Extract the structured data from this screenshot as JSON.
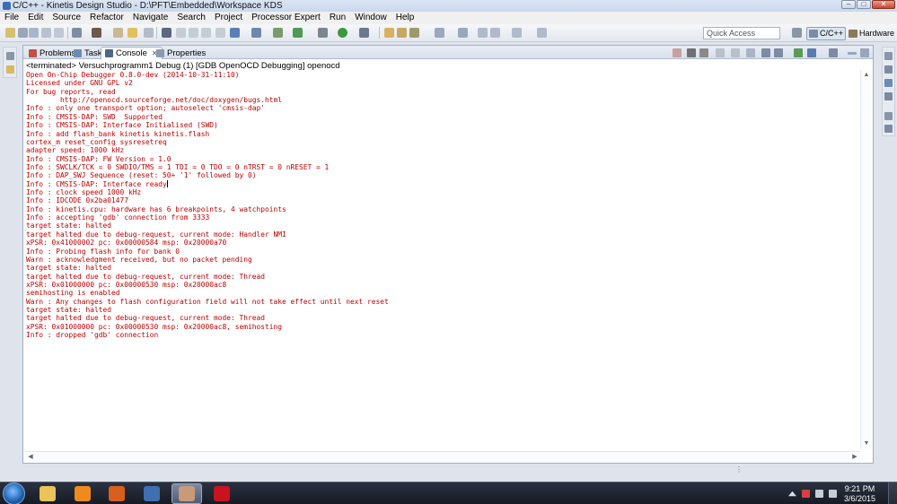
{
  "window": {
    "title": "C/C++ - Kinetis Design Studio - D:\\PFT\\Embedded\\Workspace KDS",
    "controls": {
      "minimize": "–",
      "maximize": "□",
      "close": "✕"
    }
  },
  "menu": [
    "File",
    "Edit",
    "Source",
    "Refactor",
    "Navigate",
    "Search",
    "Project",
    "Processor Expert",
    "Run",
    "Window",
    "Help"
  ],
  "toolbar": {
    "quick_access_placeholder": "Quick Access",
    "perspectives": [
      {
        "label": "C/C++",
        "active": true
      },
      {
        "label": "Hardware",
        "active": false
      }
    ]
  },
  "view_tabs": [
    {
      "label": "Problems",
      "active": false
    },
    {
      "label": "Tasks",
      "active": false
    },
    {
      "label": "Console",
      "active": true,
      "close": "✕"
    },
    {
      "label": "Properties",
      "active": false
    }
  ],
  "console": {
    "header": "<terminated> Versuchprogramm1 Debug (1) [GDB OpenOCD Debugging] openocd",
    "text_color": "#c00000",
    "lines": [
      "Open On-Chip Debugger 0.8.0-dev (2014-10-31-11:10)",
      "Licensed under GNU GPL v2",
      "For bug reports, read",
      "        http://openocd.sourceforge.net/doc/doxygen/bugs.html",
      "Info : only one transport option; autoselect 'cmsis-dap'",
      "Info : CMSIS-DAP: SWD  Supported",
      "Info : CMSIS-DAP: Interface Initialised (SWD)",
      "Info : add flash_bank kinetis kinetis.flash",
      "cortex_m reset_config sysresetreq",
      "adapter speed: 1000 kHz",
      "Info : CMSIS-DAP: FW Version = 1.0",
      "Info : SWCLK/TCK = 0 SWDIO/TMS = 1 TDI = 0 TDO = 0 nTRST = 0 nRESET = 1",
      "Info : DAP_SWJ Sequence (reset: 50+ '1' followed by 0)",
      "Info : CMSIS-DAP: Interface ready",
      "Info : clock speed 1000 kHz",
      "Info : IDCODE 0x2ba01477",
      "Info : kinetis.cpu: hardware has 6 breakpoints, 4 watchpoints",
      "Info : accepting 'gdb' connection from 3333",
      "target state: halted",
      "target halted due to debug-request, current mode: Handler NMI",
      "xPSR: 0x41000002 pc: 0x00000584 msp: 0x20000a70",
      "Info : Probing flash info for bank 0",
      "Warn : acknowledgment received, but no packet pending",
      "target state: halted",
      "target halted due to debug-request, current mode: Thread",
      "xPSR: 0x01000000 pc: 0x00000530 msp: 0x20000ac8",
      "semihosting is enabled",
      "Warn : Any changes to flash configuration field will not take effect until next reset",
      "target state: halted",
      "target halted due to debug-request, current mode: Thread",
      "xPSR: 0x01000000 pc: 0x00000530 msp: 0x20000ac8, semihosting",
      "Info : dropped 'gdb' connection"
    ]
  },
  "taskbar": {
    "apps": [
      {
        "name": "explorer",
        "icon": "folder-icon",
        "color": "#e8c45a"
      },
      {
        "name": "vlc",
        "icon": "vlc-cone-icon",
        "color": "#f08a1c"
      },
      {
        "name": "firefox",
        "icon": "firefox-icon",
        "color": "#d9601c"
      },
      {
        "name": "thunderbird",
        "icon": "thunderbird-icon",
        "color": "#3f6fb0"
      },
      {
        "name": "kinetis-design-studio",
        "icon": "kds-icon",
        "color": "#c89a7a",
        "active": true
      },
      {
        "name": "acrobat",
        "icon": "pdf-icon",
        "color": "#c8141e"
      }
    ],
    "clock": {
      "time": "9:21 PM",
      "date": "3/6/2015"
    }
  }
}
